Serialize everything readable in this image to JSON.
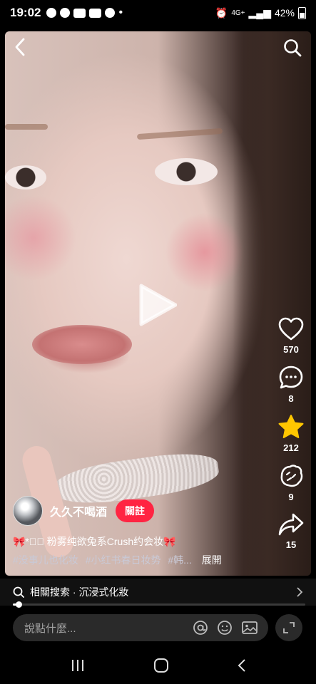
{
  "status_bar": {
    "time": "19:02",
    "signal_text": "4G+",
    "battery": "42%"
  },
  "post": {
    "author_name": "久久不喝酒",
    "follow_label": "關註",
    "caption": "🎀*☾⃝ 粉雾纯欲兔系Crush约会妆🎀",
    "tags": [
      "#没事儿也化妆",
      "#小红书春日妆势",
      "#韩..."
    ],
    "expand_label": "展開"
  },
  "actions": {
    "likes": "570",
    "comments": "8",
    "favorites": "212",
    "shares_icon_count": "9",
    "shares": "15"
  },
  "related_search": {
    "label": "相關搜索 · 沉浸式化妝"
  },
  "progress": {
    "played_fraction": 0.02
  },
  "comment_input": {
    "placeholder": "說點什麼..."
  },
  "colors": {
    "accent": "#ff2442",
    "star": "#ffc600"
  },
  "icons": [
    "back-icon",
    "search-icon",
    "play-icon",
    "heart-icon",
    "comment-icon",
    "star-icon",
    "clap-icon",
    "share-icon",
    "at-icon",
    "emoji-icon",
    "image-icon",
    "fullscreen-icon",
    "recent-apps-icon",
    "home-icon",
    "back-nav-icon"
  ]
}
